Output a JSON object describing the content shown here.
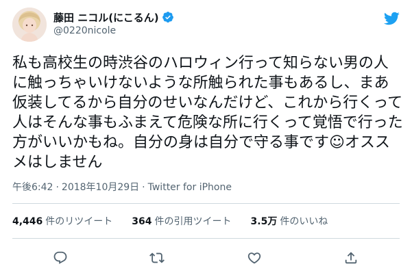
{
  "user": {
    "display_name": "藤田 ニコル(にこるん)",
    "handle": "@0220nicole",
    "verified": true,
    "avatar": "profile-photo"
  },
  "tweet": {
    "text": "私も高校生の時渋谷のハロウィン行って知らない男の人に触っちゃいけないような所触られた事もあるし、まあ仮装してるから自分のせいなんだけど、これから行くって人はそんな事もふまえて危険な所に行くって覚悟で行った方がいいかもね。自分の身は自分で守る事です☺︎オススメはしません",
    "time": "午後6:42",
    "date": "2018年10月29日",
    "separator": "·",
    "source": "Twitter for iPhone"
  },
  "stats": {
    "retweets_count": "4,446",
    "retweets_label": "件のリツイート",
    "quotes_count": "364",
    "quotes_label": "件の引用ツイート",
    "likes_count": "3.5万",
    "likes_label": "件のいいね"
  },
  "actions": [
    "reply-icon",
    "retweet-icon",
    "like-icon",
    "share-icon"
  ],
  "colors": {
    "text_primary": "#0f1419",
    "text_secondary": "#536471",
    "verified_blue": "#1d9bf0",
    "twitter_blue": "#1da1f2",
    "divider": "#cfd9de"
  }
}
